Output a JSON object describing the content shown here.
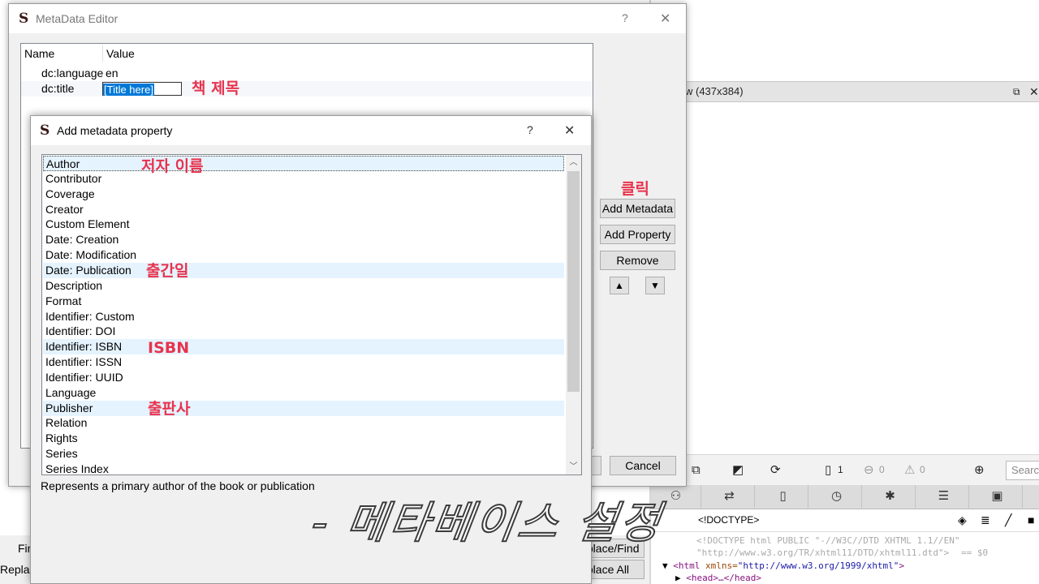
{
  "background": {
    "preview": {
      "title": "w (437x384)",
      "float_glyph": "⧉",
      "close_glyph": "✕"
    },
    "toolbar": {
      "pages_count": "1",
      "errors_count": "0",
      "warnings_count": "0",
      "search_placeholder": "Search"
    },
    "elements_bar": {
      "crumb": "<!DOCTYPE>"
    },
    "code": {
      "line1": "<!DOCTYPE html PUBLIC \"-//W3C//DTD XHTML 1.1//EN\"",
      "line2": "\"http://www.w3.org/TR/xhtml11/DTD/xhtml11.dtd\">",
      "eq": "== $0",
      "html_open": "<html",
      "html_attr": "xmlns=",
      "html_val": "\"http://www.w3.org/1999/xhtml\"",
      "html_close": ">",
      "head": "<head>…</head>"
    },
    "find_panel": {
      "find_label": "Fin",
      "replace_label": "Replac",
      "replace_find_btn": "Replace/Find",
      "replace_all_btn": "Replace All"
    }
  },
  "meta_editor": {
    "title": "MetaData Editor",
    "help_glyph": "?",
    "close_glyph": "✕",
    "columns": {
      "name": "Name",
      "value": "Value"
    },
    "rows": [
      {
        "name": "dc:language",
        "value": "en"
      },
      {
        "name": "dc:title",
        "value": "[Title here]"
      }
    ],
    "buttons": {
      "add_metadata": "Add Metadata",
      "add_property": "Add Property",
      "remove": "Remove",
      "cancel": "Cancel"
    }
  },
  "add_dialog": {
    "title": "Add metadata property",
    "help_glyph": "?",
    "close_glyph": "✕",
    "items": [
      "Author",
      "Contributor",
      "Coverage",
      "Creator",
      "Custom Element",
      "Date: Creation",
      "Date: Modification",
      "Date: Publication",
      "Description",
      "Format",
      "Identifier: Custom",
      "Identifier: DOI",
      "Identifier: ISBN",
      "Identifier: ISSN",
      "Identifier: UUID",
      "Language",
      "Publisher",
      "Relation",
      "Rights",
      "Series",
      "Series Index"
    ],
    "selected_item": "Author",
    "description": "Represents a primary author of the book or publication"
  },
  "annotations": {
    "book_title": "책 제목",
    "author_name": "저자 이름",
    "pub_date": "출간일",
    "isbn": "ISBN",
    "publisher": "출판사",
    "click": "클릭",
    "caption": "- 메타베이스 설정"
  },
  "colors": {
    "annotation": "#e8334d",
    "selection": "#0078d7",
    "highlight": "#e5f3ff"
  }
}
